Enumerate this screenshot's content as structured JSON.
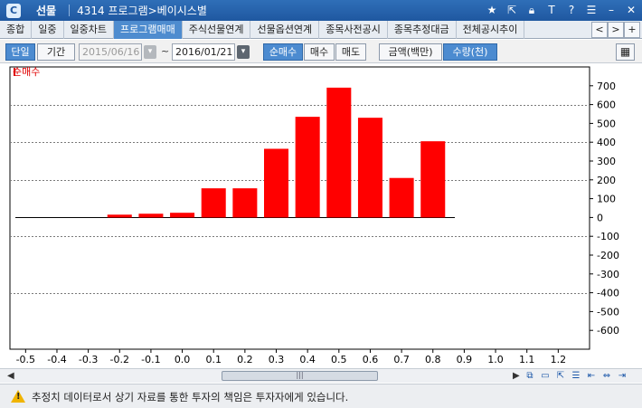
{
  "window": {
    "name": "선물",
    "path": "4314 프로그램>베이시스별",
    "icons": [
      "star-icon",
      "export-icon",
      "lock-icon",
      "text-icon",
      "help-icon",
      "list-icon",
      "minimize-icon",
      "close-icon"
    ]
  },
  "tabs": [
    {
      "label": "종합",
      "active": false
    },
    {
      "label": "일중",
      "active": false
    },
    {
      "label": "일중차트",
      "active": false
    },
    {
      "label": "프로그램매매",
      "active": true
    },
    {
      "label": "주식선물연계",
      "active": false
    },
    {
      "label": "선물옵션연계",
      "active": false
    },
    {
      "label": "종목사전공시",
      "active": false
    },
    {
      "label": "종목추정대금",
      "active": false
    },
    {
      "label": "전체공시추이",
      "active": false
    }
  ],
  "tab_nav": {
    "prev": "<",
    "next": ">",
    "add": "+"
  },
  "toolbar": {
    "single": "단일",
    "period": "기간",
    "date_from": "2015/06/16",
    "tilde": "~",
    "date_to": "2016/01/21",
    "net_buy": "순매수",
    "buy": "매수",
    "sell": "매도",
    "amount": "금액(백만)",
    "quantity": "수량(천)",
    "grid_icon": "table-grid-icon"
  },
  "chart_data": {
    "type": "bar",
    "series_name": "순매수",
    "x": [
      -0.2,
      -0.1,
      0.0,
      0.1,
      0.2,
      0.3,
      0.4,
      0.5,
      0.6,
      0.7,
      0.8
    ],
    "values": [
      15,
      20,
      25,
      155,
      155,
      365,
      535,
      690,
      530,
      210,
      405
    ],
    "x_ticks": [
      "-0.5",
      "-0.4",
      "-0.3",
      "-0.2",
      "-0.1",
      "0.0",
      "0.1",
      "0.2",
      "0.3",
      "0.4",
      "0.5",
      "0.6",
      "0.7",
      "0.8",
      "0.9",
      "1.0",
      "1.1",
      "1.2"
    ],
    "y_ticks": [
      700,
      600,
      500,
      400,
      300,
      200,
      100,
      0,
      -100,
      -200,
      -300,
      -400,
      -500,
      -600
    ],
    "ylim": [
      -700,
      800
    ],
    "xlim": [
      -0.55,
      1.3
    ],
    "bar_color": "#ff0000",
    "grid": "dashed horizontal"
  },
  "status": {
    "text": "추정치 데이터로서 상기 자료를 통한 투자의 책임은 투자자에게 있습니다.",
    "icon": "warning-icon"
  }
}
